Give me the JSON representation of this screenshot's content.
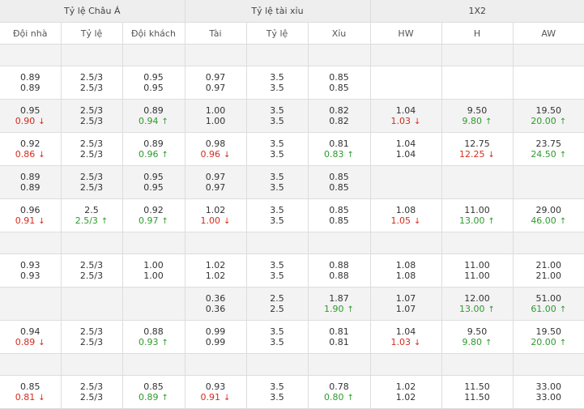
{
  "headers": {
    "groups": [
      "Tỷ lệ Châu Á",
      "Tỷ lệ tài xỉu",
      "1X2"
    ],
    "columns": [
      "Đội nhà",
      "Tỷ lệ",
      "Đội khách",
      "Tài",
      "Tỷ lệ",
      "Xỉu",
      "HW",
      "H",
      "AW"
    ]
  },
  "colors": {
    "up": "#2e9a2e",
    "down": "#d42b1e"
  },
  "rows": [
    {
      "type": "spacer"
    },
    {
      "type": "pair",
      "shade": "white",
      "line1": [
        [
          "0.89"
        ],
        [
          "2.5/3"
        ],
        [
          "0.95"
        ],
        [
          "0.97"
        ],
        [
          "3.5"
        ],
        [
          "0.85"
        ],
        [
          ""
        ],
        [
          ""
        ],
        [
          ""
        ]
      ],
      "line2": [
        [
          "0.89"
        ],
        [
          "2.5/3"
        ],
        [
          "0.95"
        ],
        [
          "0.97"
        ],
        [
          "3.5"
        ],
        [
          "0.85"
        ],
        [
          ""
        ],
        [
          ""
        ],
        [
          ""
        ]
      ]
    },
    {
      "type": "pair",
      "shade": "shaded",
      "line1": [
        [
          "0.95"
        ],
        [
          "2.5/3"
        ],
        [
          "0.89"
        ],
        [
          "1.00"
        ],
        [
          "3.5"
        ],
        [
          "0.82"
        ],
        [
          "1.04"
        ],
        [
          "9.50"
        ],
        [
          "19.50"
        ]
      ],
      "line2": [
        [
          "0.90",
          "down"
        ],
        [
          "2.5/3"
        ],
        [
          "0.94",
          "up"
        ],
        [
          "1.00"
        ],
        [
          "3.5"
        ],
        [
          "0.82"
        ],
        [
          "1.03",
          "down"
        ],
        [
          "9.80",
          "up"
        ],
        [
          "20.00",
          "up"
        ]
      ]
    },
    {
      "type": "pair",
      "shade": "white",
      "line1": [
        [
          "0.92"
        ],
        [
          "2.5/3"
        ],
        [
          "0.89"
        ],
        [
          "0.98"
        ],
        [
          "3.5"
        ],
        [
          "0.81"
        ],
        [
          "1.04"
        ],
        [
          "12.75"
        ],
        [
          "23.75"
        ]
      ],
      "line2": [
        [
          "0.86",
          "down"
        ],
        [
          "2.5/3"
        ],
        [
          "0.96",
          "up"
        ],
        [
          "0.96",
          "down"
        ],
        [
          "3.5"
        ],
        [
          "0.83",
          "up"
        ],
        [
          "1.04"
        ],
        [
          "12.25",
          "down"
        ],
        [
          "24.50",
          "up"
        ]
      ]
    },
    {
      "type": "pair",
      "shade": "shaded",
      "line1": [
        [
          "0.89"
        ],
        [
          "2.5/3"
        ],
        [
          "0.95"
        ],
        [
          "0.97"
        ],
        [
          "3.5"
        ],
        [
          "0.85"
        ],
        [
          ""
        ],
        [
          ""
        ],
        [
          ""
        ]
      ],
      "line2": [
        [
          "0.89"
        ],
        [
          "2.5/3"
        ],
        [
          "0.95"
        ],
        [
          "0.97"
        ],
        [
          "3.5"
        ],
        [
          "0.85"
        ],
        [
          ""
        ],
        [
          ""
        ],
        [
          ""
        ]
      ]
    },
    {
      "type": "pair",
      "shade": "white",
      "line1": [
        [
          "0.96"
        ],
        [
          "2.5"
        ],
        [
          "0.92"
        ],
        [
          "1.02"
        ],
        [
          "3.5"
        ],
        [
          "0.85"
        ],
        [
          "1.08"
        ],
        [
          "11.00"
        ],
        [
          "29.00"
        ]
      ],
      "line2": [
        [
          "0.91",
          "down"
        ],
        [
          "2.5/3",
          "up"
        ],
        [
          "0.97",
          "up"
        ],
        [
          "1.00",
          "down"
        ],
        [
          "3.5"
        ],
        [
          "0.85"
        ],
        [
          "1.05",
          "down"
        ],
        [
          "13.00",
          "up"
        ],
        [
          "46.00",
          "up"
        ]
      ]
    },
    {
      "type": "spacer"
    },
    {
      "type": "pair",
      "shade": "white",
      "line1": [
        [
          "0.93"
        ],
        [
          "2.5/3"
        ],
        [
          "1.00"
        ],
        [
          "1.02"
        ],
        [
          "3.5"
        ],
        [
          "0.88"
        ],
        [
          "1.08"
        ],
        [
          "11.00"
        ],
        [
          "21.00"
        ]
      ],
      "line2": [
        [
          "0.93"
        ],
        [
          "2.5/3"
        ],
        [
          "1.00"
        ],
        [
          "1.02"
        ],
        [
          "3.5"
        ],
        [
          "0.88"
        ],
        [
          "1.08"
        ],
        [
          "11.00"
        ],
        [
          "21.00"
        ]
      ]
    },
    {
      "type": "pair",
      "shade": "shaded",
      "line1": [
        [
          ""
        ],
        [
          ""
        ],
        [
          ""
        ],
        [
          "0.36"
        ],
        [
          "2.5"
        ],
        [
          "1.87"
        ],
        [
          "1.07"
        ],
        [
          "12.00"
        ],
        [
          "51.00"
        ]
      ],
      "line2": [
        [
          ""
        ],
        [
          ""
        ],
        [
          ""
        ],
        [
          "0.36"
        ],
        [
          "2.5"
        ],
        [
          "1.90",
          "up"
        ],
        [
          "1.07"
        ],
        [
          "13.00",
          "up"
        ],
        [
          "61.00",
          "up"
        ]
      ]
    },
    {
      "type": "pair",
      "shade": "white",
      "line1": [
        [
          "0.94"
        ],
        [
          "2.5/3"
        ],
        [
          "0.88"
        ],
        [
          "0.99"
        ],
        [
          "3.5"
        ],
        [
          "0.81"
        ],
        [
          "1.04"
        ],
        [
          "9.50"
        ],
        [
          "19.50"
        ]
      ],
      "line2": [
        [
          "0.89",
          "down"
        ],
        [
          "2.5/3"
        ],
        [
          "0.93",
          "up"
        ],
        [
          "0.99"
        ],
        [
          "3.5"
        ],
        [
          "0.81"
        ],
        [
          "1.03",
          "down"
        ],
        [
          "9.80",
          "up"
        ],
        [
          "20.00",
          "up"
        ]
      ]
    },
    {
      "type": "spacer"
    },
    {
      "type": "pair",
      "shade": "white",
      "line1": [
        [
          "0.85"
        ],
        [
          "2.5/3"
        ],
        [
          "0.85"
        ],
        [
          "0.93"
        ],
        [
          "3.5"
        ],
        [
          "0.78"
        ],
        [
          "1.02"
        ],
        [
          "11.50"
        ],
        [
          "33.00"
        ]
      ],
      "line2": [
        [
          "0.81",
          "down"
        ],
        [
          "2.5/3"
        ],
        [
          "0.89",
          "up"
        ],
        [
          "0.91",
          "down"
        ],
        [
          "3.5"
        ],
        [
          "0.80",
          "up"
        ],
        [
          "1.02"
        ],
        [
          "11.50"
        ],
        [
          "33.00"
        ]
      ]
    }
  ]
}
